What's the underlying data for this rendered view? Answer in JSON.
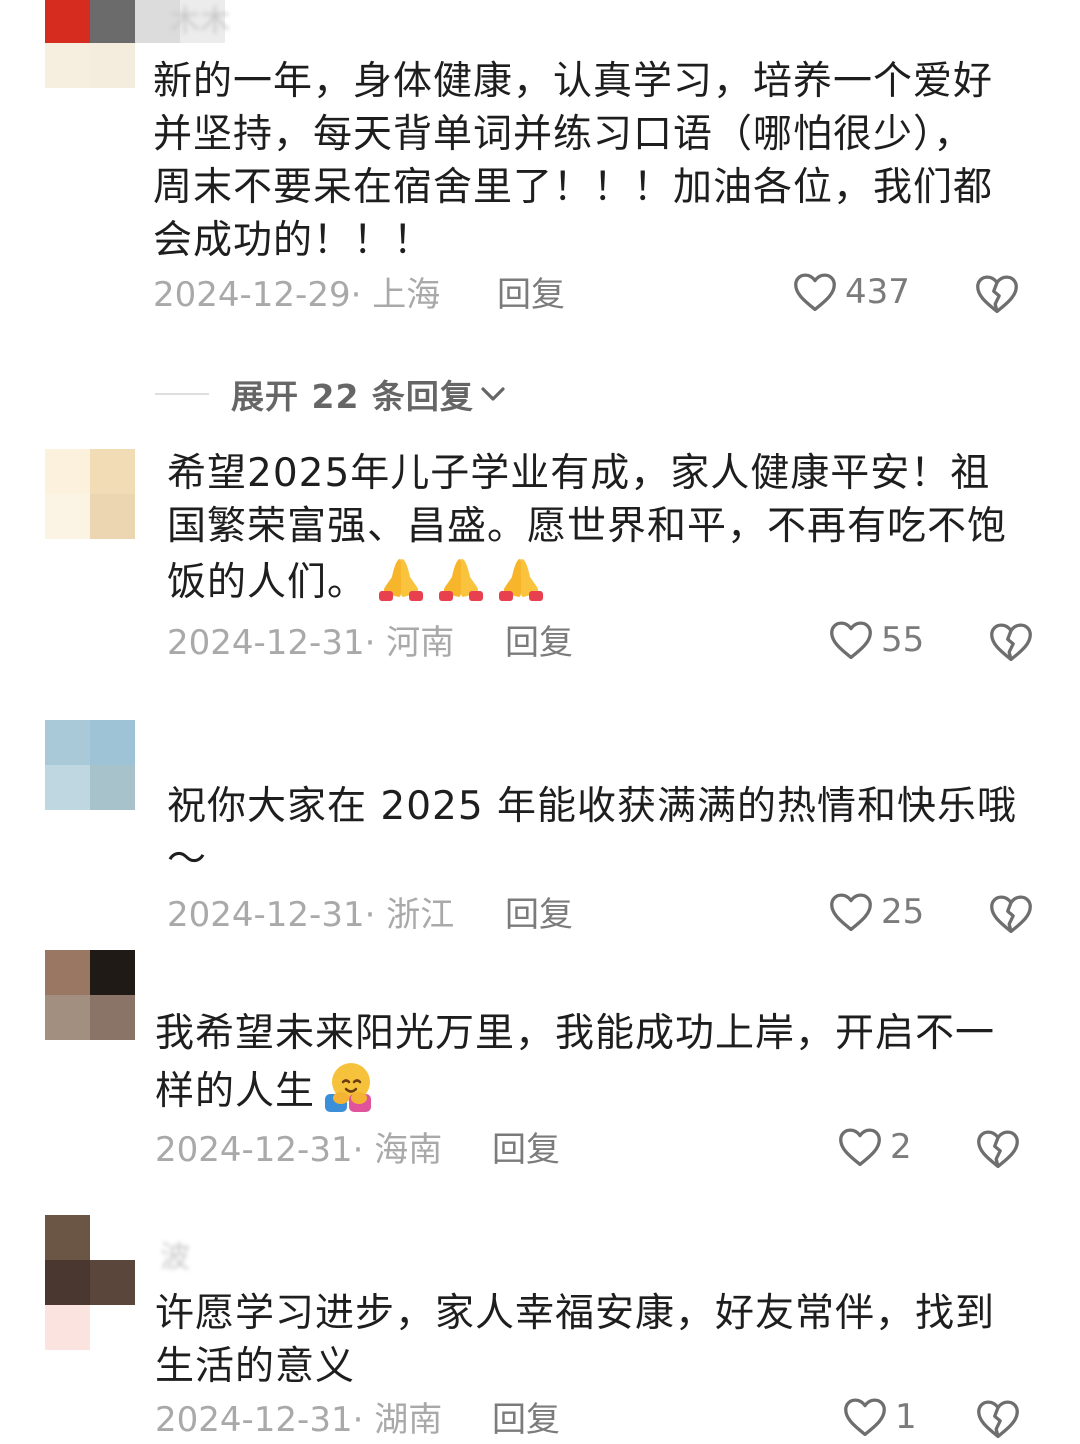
{
  "comments": [
    {
      "username": "木木",
      "text": "新的一年，身体健康，认真学习，培养一个爱好\n并坚持，每天背单词并练习口语（哪怕很少），\n周末不要呆在宿舍里了！！！加油各位，我们都\n会成功的！！！",
      "date_location": "2024-12-29· 上海",
      "reply_label": "回复",
      "likes": "437"
    },
    {
      "username": "",
      "text": "希望2025年儿子学业有成，家人健康平安！祖\n国繁荣富强、昌盛。愿世界和平，不再有吃不饱\n饭的人们。",
      "emoji": [
        "pray-emoji",
        "pray-emoji",
        "pray-emoji"
      ],
      "date_location": "2024-12-31· 河南",
      "reply_label": "回复",
      "likes": "55"
    },
    {
      "username": "",
      "text": "祝你大家在 2025 年能收获满满的热情和快乐哦\n～",
      "date_location": "2024-12-31· 浙江",
      "reply_label": "回复",
      "likes": "25"
    },
    {
      "username": "",
      "text": "我希望未来阳光万里，我能成功上岸，开启不一\n样的人生",
      "emoji": [
        "hug-emoji"
      ],
      "date_location": "2024-12-31· 海南",
      "reply_label": "回复",
      "likes": "2"
    },
    {
      "username": "波",
      "text": "许愿学习进步，家人幸福安康，好友常伴，找到\n生活的意义",
      "date_location": "2024-12-31· 湖南",
      "reply_label": "回复",
      "likes": "1"
    }
  ],
  "expand_replies": {
    "label": "展开 22 条回复"
  },
  "icons": {
    "like": "heart-outline-icon",
    "dislike": "broken-heart-icon",
    "expand": "chevron-down-icon"
  },
  "colors": {
    "text": "#1e1e1e",
    "meta": "#a9a9a9",
    "action": "#7b7b7b",
    "pray_emoji": "#f7b52c"
  }
}
